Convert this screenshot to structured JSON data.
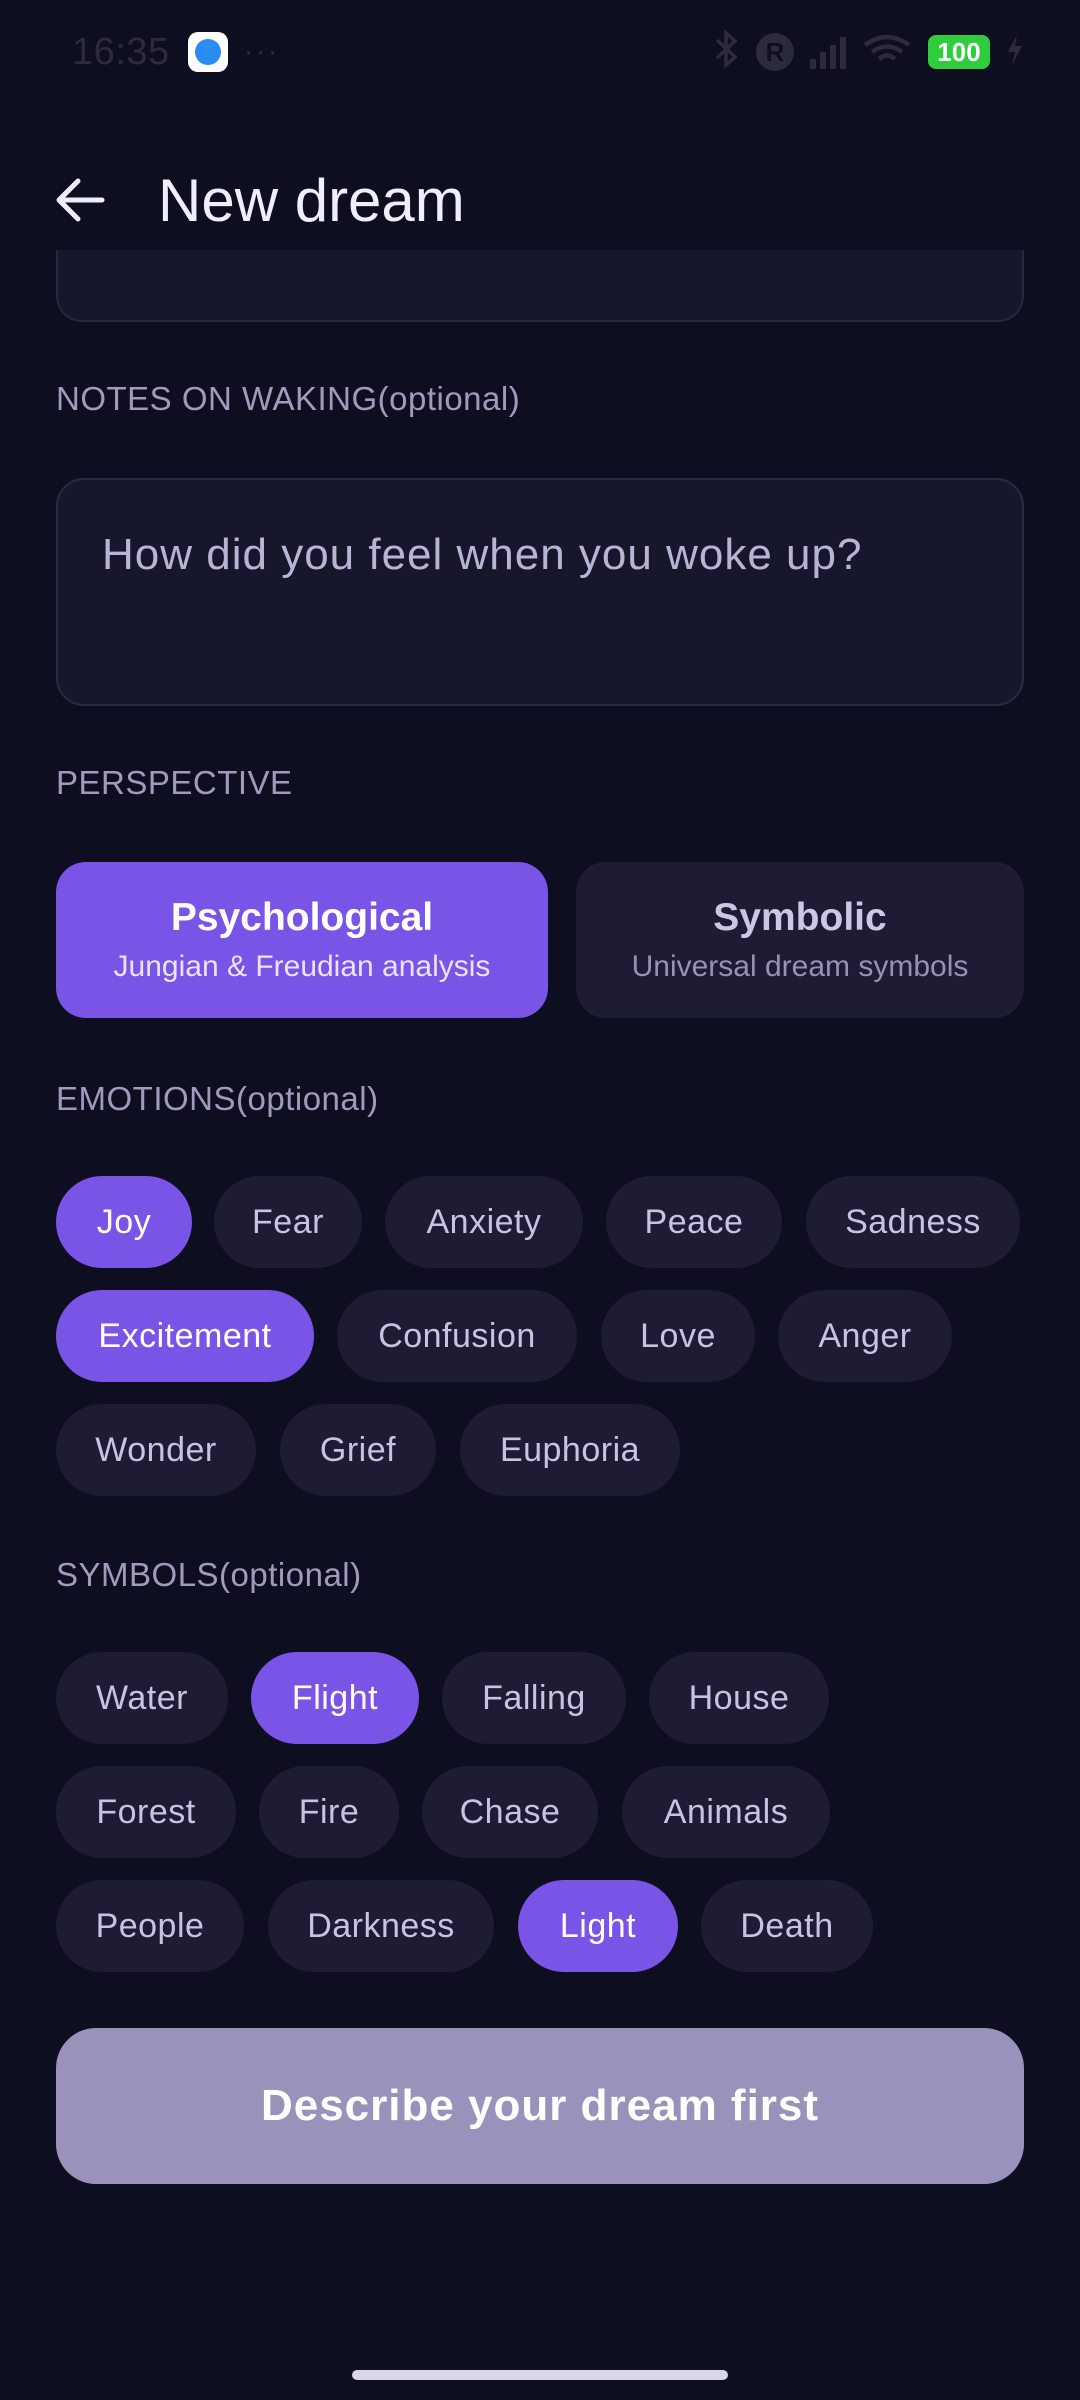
{
  "status_bar": {
    "time": "16:35",
    "more": "···",
    "battery": "100",
    "icons": [
      "app-icon",
      "bluetooth-icon",
      "r-icon",
      "signal-icon",
      "wifi-icon",
      "battery-icon",
      "charging-icon"
    ]
  },
  "header": {
    "title": "New dream",
    "back_icon": "arrow-left-icon"
  },
  "notes": {
    "label": "NOTES ON WAKING(optional)",
    "placeholder": "How did you feel when you woke up?"
  },
  "perspective": {
    "label": "PERSPECTIVE",
    "options": [
      {
        "title": "Psychological",
        "subtitle": "Jungian & Freudian analysis",
        "selected": true
      },
      {
        "title": "Symbolic",
        "subtitle": "Universal dream symbols",
        "selected": false
      }
    ]
  },
  "emotions": {
    "label": "EMOTIONS(optional)",
    "chips": [
      {
        "label": "Joy",
        "selected": true
      },
      {
        "label": "Fear",
        "selected": false
      },
      {
        "label": "Anxiety",
        "selected": false
      },
      {
        "label": "Peace",
        "selected": false
      },
      {
        "label": "Sadness",
        "selected": false
      },
      {
        "label": "Excitement",
        "selected": true
      },
      {
        "label": "Confusion",
        "selected": false
      },
      {
        "label": "Love",
        "selected": false
      },
      {
        "label": "Anger",
        "selected": false
      },
      {
        "label": "Wonder",
        "selected": false
      },
      {
        "label": "Grief",
        "selected": false
      },
      {
        "label": "Euphoria",
        "selected": false
      }
    ]
  },
  "symbols": {
    "label": "SYMBOLS(optional)",
    "chips": [
      {
        "label": "Water",
        "selected": false
      },
      {
        "label": "Flight",
        "selected": true
      },
      {
        "label": "Falling",
        "selected": false
      },
      {
        "label": "House",
        "selected": false
      },
      {
        "label": "Forest",
        "selected": false
      },
      {
        "label": "Fire",
        "selected": false
      },
      {
        "label": "Chase",
        "selected": false
      },
      {
        "label": "Animals",
        "selected": false
      },
      {
        "label": "People",
        "selected": false
      },
      {
        "label": "Darkness",
        "selected": false
      },
      {
        "label": "Light",
        "selected": true
      },
      {
        "label": "Death",
        "selected": false
      }
    ]
  },
  "cta": {
    "label": "Describe your dream first",
    "enabled": false
  },
  "colors": {
    "background": "#0e0e21",
    "accent": "#7a54e6",
    "chip": "#1d1c33",
    "cta_disabled": "#9a92ba"
  }
}
